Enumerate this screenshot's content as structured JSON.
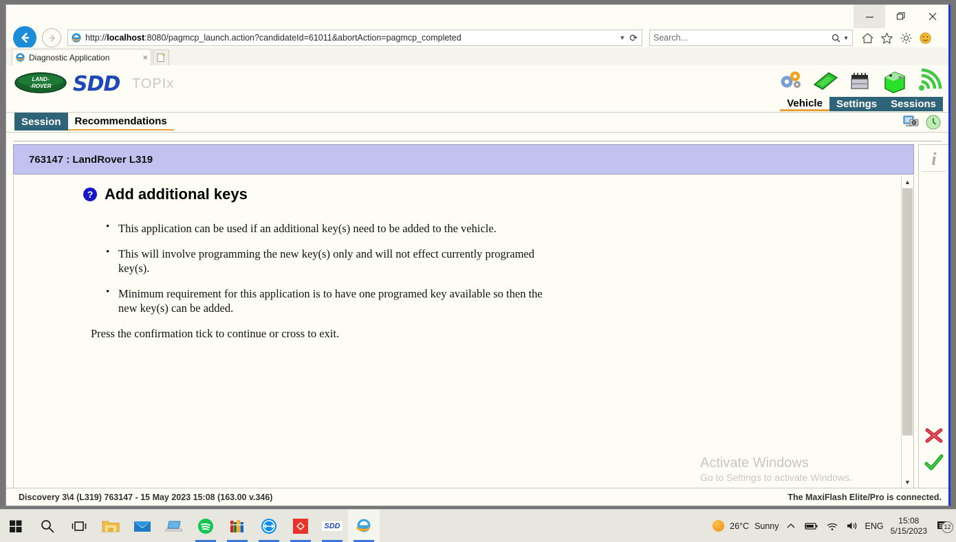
{
  "browser": {
    "window_controls": {
      "minimize": "minimize-icon",
      "maximize": "restore-icon",
      "close": "close-icon"
    },
    "back_label": "back-arrow",
    "forward_label": "forward-arrow",
    "address": {
      "url_prefix": "http://",
      "url_host": "localhost",
      "url_rest": ":8080/pagmcp_launch.action?candidateId=61011&abortAction=pagmcp_completed",
      "dropdown_icon": "chevron-down-icon",
      "refresh_icon": "refresh-icon"
    },
    "search": {
      "placeholder": "Search...",
      "search_icon": "search-icon",
      "dropdown_icon": "chevron-down-icon"
    },
    "toolbar_icons": [
      "home-icon",
      "favorites-star-icon",
      "gear-icon",
      "smiley-feedback-icon"
    ],
    "tab": {
      "title": "Diagnostic Application",
      "close": "×",
      "new_tab_icon": "new-tab-icon"
    }
  },
  "app": {
    "brand": {
      "logo": "land-rover-logo",
      "logo_line1": "LAND-",
      "logo_line2": "ROVER",
      "sdd": "SDD",
      "topix": "TOPIx"
    },
    "header_icons": [
      "settings-gears-icon",
      "green-card-icon",
      "battery-icon",
      "green-box-icon",
      "wifi-signal-icon"
    ],
    "nav_tabs": [
      {
        "label": "Vehicle",
        "active": true
      },
      {
        "label": "Settings",
        "active": false
      },
      {
        "label": "Sessions",
        "active": false
      }
    ],
    "sub_tabs": [
      {
        "label": "Session",
        "state": "selected"
      },
      {
        "label": "Recommendations",
        "state": "current"
      }
    ],
    "sub_right_icons": [
      "screenshot-camera-icon",
      "clock-history-icon"
    ],
    "vehicle_bar": "763147 : LandRover L319",
    "document": {
      "help_icon": "help-question-icon",
      "title": "Add additional keys",
      "bullets": [
        "This application can be used if an additional key(s) need to be added to the vehicle.",
        "This will involve programming the new key(s) only and will not effect currently programed key(s).",
        "Minimum requirement for this application is to have one programed key available so then the new key(s) can be added."
      ],
      "press_note": "Press the confirmation tick to continue or cross to exit.",
      "scroll_up_icon": "scroll-up-arrow",
      "scroll_down_icon": "scroll-down-arrow"
    },
    "side_panel": {
      "info_icon": "information-i-icon",
      "cancel_icon": "red-cross-icon",
      "confirm_icon": "green-tick-icon"
    },
    "status_left": "Discovery 3\\4 (L319) 763147 - 15 May 2023 15:08 (163.00 v.346)",
    "status_right": "The MaxiFlash Elite/Pro is connected."
  },
  "watermark": {
    "line1": "Activate Windows",
    "line2": "Go to Settings to activate Windows."
  },
  "taskbar": {
    "items": [
      {
        "name": "start-button",
        "icon": "windows-logo-icon"
      },
      {
        "name": "search-button",
        "icon": "search-icon"
      },
      {
        "name": "task-view-button",
        "icon": "task-view-icon"
      },
      {
        "name": "file-explorer-button",
        "icon": "folder-icon"
      },
      {
        "name": "mail-button",
        "icon": "mail-envelope-icon"
      },
      {
        "name": "laptop-app-button",
        "icon": "laptop-icon"
      },
      {
        "name": "spotify-button",
        "icon": "spotify-icon"
      },
      {
        "name": "winrar-button",
        "icon": "winrar-books-icon"
      },
      {
        "name": "teamviewer-button",
        "icon": "teamviewer-icon"
      },
      {
        "name": "red-app-button",
        "icon": "red-diamond-icon"
      },
      {
        "name": "sdd-button",
        "icon": "sdd-text-icon",
        "label": "SDD"
      },
      {
        "name": "internet-explorer-button",
        "icon": "internet-explorer-icon",
        "active": true
      }
    ],
    "weather": {
      "temperature": "26°C",
      "condition": "Sunny",
      "icon": "sun-icon"
    },
    "tray": [
      "show-hidden-icons-chevron",
      "battery-icon",
      "wifi-icon",
      "volume-icon"
    ],
    "language": "ENG",
    "clock": {
      "time": "15:08",
      "date": "5/15/2023"
    },
    "notifications": {
      "icon": "notification-icon",
      "count": "12"
    }
  },
  "colors": {
    "nav_tab_active_underline": "#e8a33d",
    "nav_tab_bg": "#2f6377",
    "vehicle_bar_bg": "#c2c2f0",
    "sdd_blue": "#1d48b5",
    "land_rover_green": "#1d6b33",
    "confirm_green": "#17a81a",
    "cancel_red": "#cc1f2e"
  }
}
